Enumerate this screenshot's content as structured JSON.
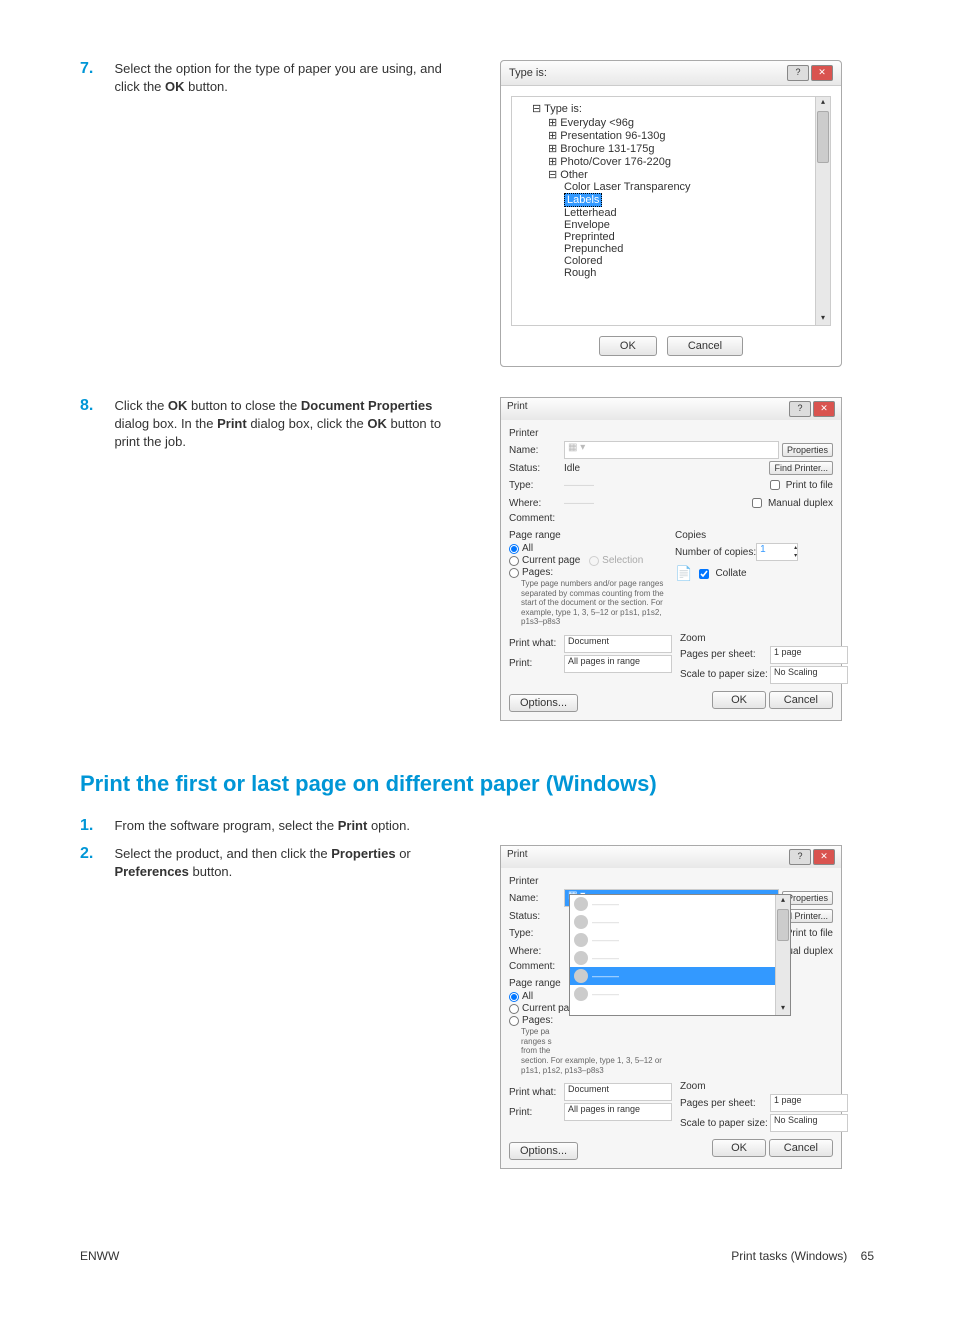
{
  "step7": {
    "num": "7.",
    "text_before": "Select the option for the type of paper you are using, and click the ",
    "bold": "OK",
    "text_after": " button."
  },
  "step8": {
    "num": "8.",
    "parts": [
      "Click the ",
      "OK",
      " button to close the ",
      "Document Properties",
      " dialog box. In the ",
      "Print",
      " dialog box, click the ",
      "OK",
      " button to print the job."
    ]
  },
  "type_dialog": {
    "title": "Type is:",
    "root": "Type is:",
    "items": [
      "Everyday <96g",
      "Presentation 96-130g",
      "Brochure 131-175g",
      "Photo/Cover 176-220g",
      "Other"
    ],
    "sub_items": [
      "Color Laser Transparency",
      "Labels",
      "Letterhead",
      "Envelope",
      "Preprinted",
      "Prepunched",
      "Colored",
      "Rough"
    ],
    "selected": "Labels",
    "ok": "OK",
    "cancel": "Cancel"
  },
  "print_dialog": {
    "title": "Print",
    "printer_section": "Printer",
    "name_label": "Name:",
    "status_label": "Status:",
    "status_value": "Idle",
    "type_label": "Type:",
    "where_label": "Where:",
    "comment_label": "Comment:",
    "properties": "Properties",
    "find_printer": "Find Printer...",
    "print_to_file": "Print to file",
    "manual_duplex": "Manual duplex",
    "page_range": "Page range",
    "all": "All",
    "current": "Current page",
    "selection": "Selection",
    "pages": "Pages:",
    "pages_note": "Type page numbers and/or page ranges separated by commas counting from the start of the document or the section. For example, type 1, 3, 5–12 or p1s1, p1s2, p1s3–p8s3",
    "copies": "Copies",
    "num_copies": "Number of copies:",
    "copies_value": "1",
    "collate": "Collate",
    "print_what": "Print what:",
    "print_what_val": "Document",
    "print_label": "Print:",
    "print_val": "All pages in range",
    "zoom": "Zoom",
    "pages_per_sheet": "Pages per sheet:",
    "pps_val": "1 page",
    "scale": "Scale to paper size:",
    "scale_val": "No Scaling",
    "options": "Options...",
    "ok": "OK",
    "cancel": "Cancel"
  },
  "heading": "Print the first or last page on different paper (Windows)",
  "step1": {
    "num": "1.",
    "text_before": "From the software program, select the ",
    "bold": "Print",
    "text_after": " option."
  },
  "step2": {
    "num": "2.",
    "text_before": "Select the product, and then click the ",
    "bold1": "Properties",
    "text_mid": " or ",
    "bold2": "Preferences",
    "text_after": " button."
  },
  "pages_note_short": "section. For example, type 1, 3, 5–12 or p1s1, p1s2, p1s3–p8s3",
  "footer": {
    "left": "ENWW",
    "right_text": "Print tasks (Windows)",
    "right_num": "65"
  }
}
